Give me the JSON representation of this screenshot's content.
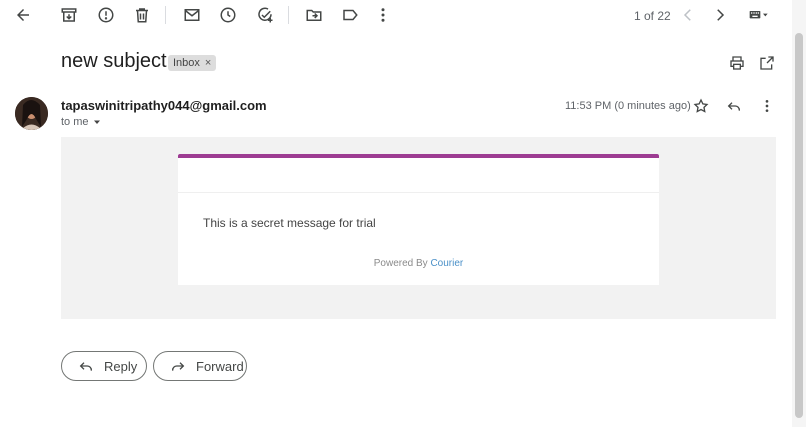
{
  "toolbar": {
    "back_icon": "arrow-back-icon",
    "archive_icon": "archive-icon",
    "spam_icon": "report-spam-icon",
    "delete_icon": "trash-icon",
    "unread_icon": "mail-icon",
    "snooze_icon": "clock-icon",
    "task_icon": "add-task-icon",
    "move_icon": "folder-move-icon",
    "label_icon": "label-icon",
    "more_icon": "more-vert-icon",
    "pager_text": "1 of 22",
    "keyboard_icon": "keyboard-icon"
  },
  "message": {
    "subject": "new subject",
    "label": "Inbox",
    "label_remove": "×",
    "sender": "tapaswinitripathy044@gmail.com",
    "to": "to me",
    "timestamp": "11:53 PM (0 minutes ago)",
    "body_text": "This is a secret message for trial",
    "powered_prefix": "Powered By",
    "powered_link": "Courier"
  },
  "colors": {
    "brand_bar": "#9d3c92",
    "link": "#4a90c8"
  },
  "actions": {
    "reply": "Reply",
    "forward": "Forward"
  }
}
